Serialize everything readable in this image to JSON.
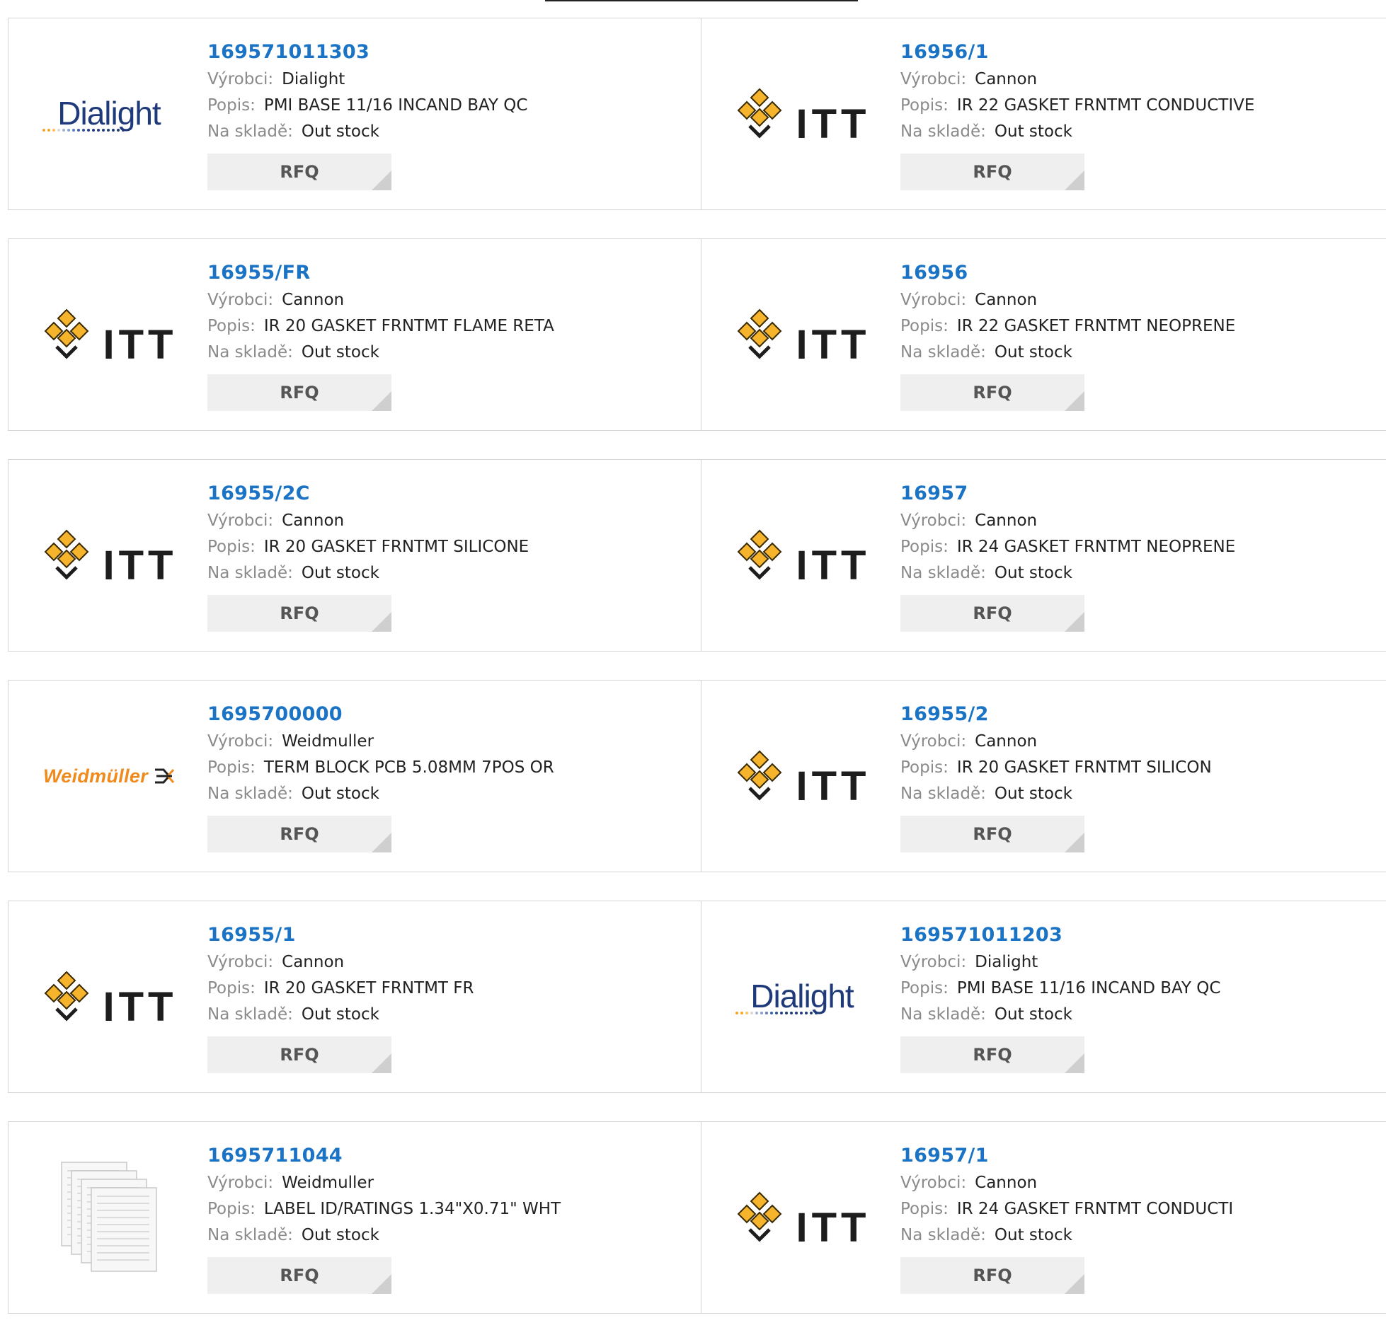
{
  "labels": {
    "manufacturer": "Výrobci:",
    "description": "Popis:",
    "stock": "Na skladě:",
    "rfq": "RFQ"
  },
  "logos": {
    "dialight": "Dialight",
    "itt": "ITT",
    "weidmuller": "Weidmüller"
  },
  "colors": {
    "link": "#1a73c4",
    "label": "#8a8a8a",
    "itt_yellow": "#f5b42c",
    "weidmuller_orange": "#f08a1c",
    "dialight_blue": "#1f3a7a"
  },
  "products": [
    {
      "part": "169571011303",
      "logo": "dialight",
      "manufacturer": "Dialight",
      "description": "PMI BASE 11/16 INCAND BAY QC",
      "stock": "Out stock"
    },
    {
      "part": "16956/1",
      "logo": "itt",
      "manufacturer": "Cannon",
      "description": "IR 22 GASKET FRNTMT CONDUCTIVE",
      "stock": "Out stock"
    },
    {
      "part": "16955/FR",
      "logo": "itt",
      "manufacturer": "Cannon",
      "description": "IR 20 GASKET FRNTMT FLAME RETA",
      "stock": "Out stock"
    },
    {
      "part": "16956",
      "logo": "itt",
      "manufacturer": "Cannon",
      "description": "IR 22 GASKET FRNTMT NEOPRENE",
      "stock": "Out stock"
    },
    {
      "part": "16955/2C",
      "logo": "itt",
      "manufacturer": "Cannon",
      "description": "IR 20 GASKET FRNTMT SILICONE",
      "stock": "Out stock"
    },
    {
      "part": "16957",
      "logo": "itt",
      "manufacturer": "Cannon",
      "description": "IR 24 GASKET FRNTMT NEOPRENE",
      "stock": "Out stock"
    },
    {
      "part": "1695700000",
      "logo": "weidmuller",
      "manufacturer": "Weidmuller",
      "description": "TERM BLOCK PCB 5.08MM 7POS OR",
      "stock": "Out stock"
    },
    {
      "part": "16955/2",
      "logo": "itt",
      "manufacturer": "Cannon",
      "description": "IR 20 GASKET FRNTMT SILICON",
      "stock": "Out stock"
    },
    {
      "part": "16955/1",
      "logo": "itt",
      "manufacturer": "Cannon",
      "description": "IR 20 GASKET FRNTMT FR",
      "stock": "Out stock"
    },
    {
      "part": "169571011203",
      "logo": "dialight",
      "manufacturer": "Dialight",
      "description": "PMI BASE 11/16 INCAND BAY QC",
      "stock": "Out stock"
    },
    {
      "part": "1695711044",
      "logo": "label-sheet",
      "manufacturer": "Weidmuller",
      "description": "LABEL ID/RATINGS 1.34\"X0.71\" WHT",
      "stock": "Out stock"
    },
    {
      "part": "16957/1",
      "logo": "itt",
      "manufacturer": "Cannon",
      "description": "IR 24 GASKET FRNTMT CONDUCTI",
      "stock": "Out stock"
    }
  ]
}
